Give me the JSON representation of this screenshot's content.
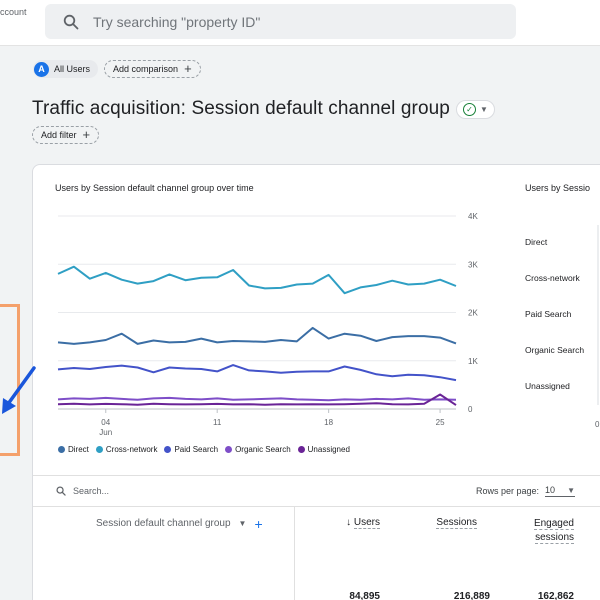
{
  "header": {
    "account_fragment": "ccount",
    "search_placeholder": "Try searching \"property ID\""
  },
  "comparison": {
    "segment_badge": "A",
    "segment_label": "All Users",
    "add_comparison": "Add comparison"
  },
  "page": {
    "title": "Traffic acquisition: Session default channel group",
    "add_filter": "Add filter"
  },
  "colors": {
    "Direct": "#3b6ea5",
    "Cross-network": "#2f9fc4",
    "Paid Search": "#4353c9",
    "Organic Search": "#7e4ec8",
    "Unassigned": "#6a2496",
    "accent": "#1a73e8",
    "highlight": "#f4a06b"
  },
  "chart_data": [
    {
      "type": "line",
      "title": "Users by Session default channel group over time",
      "x_ticks": [
        {
          "day": "04",
          "month": "Jun"
        },
        {
          "day": "11",
          "month": ""
        },
        {
          "day": "18",
          "month": ""
        },
        {
          "day": "25",
          "month": ""
        }
      ],
      "y_ticks": [
        "4K",
        "3K",
        "2K",
        "1K",
        "0"
      ],
      "ylim": [
        0,
        4000
      ],
      "grid": true,
      "legend_position": "bottom-left",
      "series": [
        {
          "name": "Cross-network",
          "values": [
            2800,
            2950,
            2700,
            2820,
            2680,
            2600,
            2650,
            2790,
            2670,
            2720,
            2730,
            2880,
            2560,
            2500,
            2510,
            2580,
            2600,
            2780,
            2400,
            2520,
            2570,
            2660,
            2580,
            2600,
            2680,
            2550
          ]
        },
        {
          "name": "Direct",
          "values": [
            1380,
            1350,
            1380,
            1430,
            1560,
            1350,
            1420,
            1380,
            1390,
            1460,
            1380,
            1410,
            1400,
            1390,
            1430,
            1400,
            1680,
            1460,
            1560,
            1520,
            1410,
            1490,
            1510,
            1510,
            1480,
            1360
          ]
        },
        {
          "name": "Paid Search",
          "values": [
            820,
            850,
            830,
            870,
            900,
            860,
            760,
            860,
            840,
            830,
            780,
            910,
            800,
            780,
            750,
            770,
            780,
            780,
            880,
            810,
            720,
            680,
            710,
            700,
            660,
            600
          ]
        },
        {
          "name": "Organic Search",
          "values": [
            200,
            220,
            210,
            230,
            210,
            190,
            220,
            230,
            210,
            200,
            220,
            190,
            200,
            210,
            220,
            200,
            190,
            180,
            200,
            190,
            210,
            200,
            220,
            190,
            200,
            190
          ]
        },
        {
          "name": "Unassigned",
          "values": [
            100,
            110,
            95,
            105,
            100,
            90,
            110,
            100,
            95,
            100,
            105,
            95,
            100,
            90,
            100,
            95,
            100,
            95,
            100,
            110,
            120,
            100,
            95,
            110,
            300,
            80
          ]
        }
      ]
    },
    {
      "type": "bar",
      "title": "Users by Sessio",
      "categories": [
        "Direct",
        "Cross-network",
        "Paid Search",
        "Organic Search",
        "Unassigned"
      ],
      "x_ticks": [
        "0"
      ]
    }
  ],
  "table": {
    "search_placeholder": "Search...",
    "rows_per_page_label": "Rows per page:",
    "rows_per_page_value": "10",
    "dimension_header": "Session default channel group",
    "columns": [
      {
        "label": "Users",
        "sorted": true
      },
      {
        "label": "Sessions"
      },
      {
        "label": "Engaged",
        "label2": "sessions"
      }
    ],
    "totals": [
      "84,895",
      "216,889",
      "162,862"
    ]
  }
}
